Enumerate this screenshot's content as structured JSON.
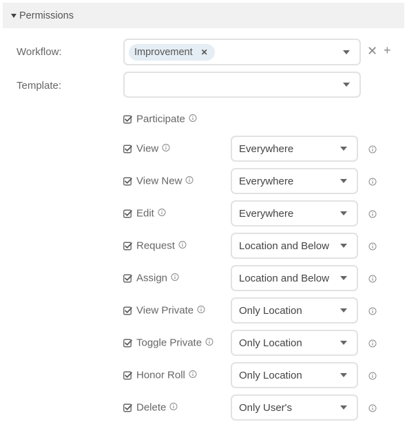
{
  "section": {
    "title": "Permissions"
  },
  "workflow": {
    "label": "Workflow:",
    "tags": [
      "Improvement"
    ]
  },
  "template": {
    "label": "Template:",
    "value": ""
  },
  "permissions": [
    {
      "label": "Participate",
      "checked": true,
      "scope": null
    },
    {
      "label": "View",
      "checked": true,
      "scope": "Everywhere"
    },
    {
      "label": "View New",
      "checked": true,
      "scope": "Everywhere"
    },
    {
      "label": "Edit",
      "checked": true,
      "scope": "Everywhere"
    },
    {
      "label": "Request",
      "checked": true,
      "scope": "Location and Below"
    },
    {
      "label": "Assign",
      "checked": true,
      "scope": "Location and Below"
    },
    {
      "label": "View Private",
      "checked": true,
      "scope": "Only Location"
    },
    {
      "label": "Toggle Private",
      "checked": true,
      "scope": "Only Location"
    },
    {
      "label": "Honor Roll",
      "checked": true,
      "scope": "Only Location"
    },
    {
      "label": "Delete",
      "checked": true,
      "scope": "Only User's"
    }
  ]
}
